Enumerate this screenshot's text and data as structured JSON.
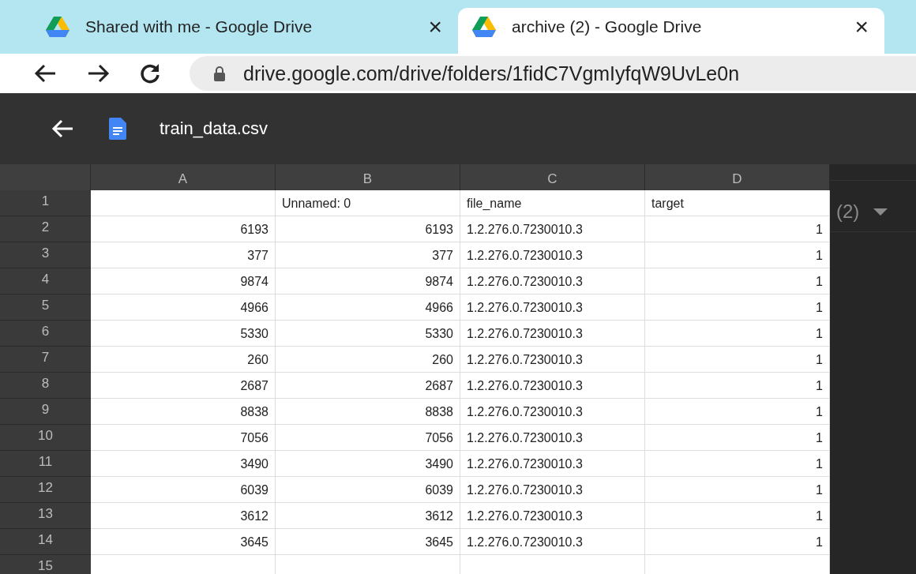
{
  "browser": {
    "tabs": [
      {
        "title": "Shared with me - Google Drive",
        "close": "×",
        "selected": false
      },
      {
        "title": "archive (2) - Google Drive",
        "close": "×",
        "selected": true
      }
    ],
    "url": "drive.google.com/drive/folders/1fidC7VgmIyfqW9UvLe0n"
  },
  "viewer": {
    "file_name": "train_data.csv",
    "background_text": "(2)"
  },
  "sheet": {
    "columns": [
      "A",
      "B",
      "C",
      "D"
    ],
    "rows": [
      {
        "number": "1",
        "cells": [
          "",
          "Unnamed: 0",
          "file_name",
          "target"
        ]
      },
      {
        "number": "2",
        "cells": [
          "6193",
          "6193",
          "1.2.276.0.7230010.3",
          "1"
        ]
      },
      {
        "number": "3",
        "cells": [
          "377",
          "377",
          "1.2.276.0.7230010.3",
          "1"
        ]
      },
      {
        "number": "4",
        "cells": [
          "9874",
          "9874",
          "1.2.276.0.7230010.3",
          "1"
        ]
      },
      {
        "number": "5",
        "cells": [
          "4966",
          "4966",
          "1.2.276.0.7230010.3",
          "1"
        ]
      },
      {
        "number": "6",
        "cells": [
          "5330",
          "5330",
          "1.2.276.0.7230010.3",
          "1"
        ]
      },
      {
        "number": "7",
        "cells": [
          "260",
          "260",
          "1.2.276.0.7230010.3",
          "1"
        ]
      },
      {
        "number": "8",
        "cells": [
          "2687",
          "2687",
          "1.2.276.0.7230010.3",
          "1"
        ]
      },
      {
        "number": "9",
        "cells": [
          "8838",
          "8838",
          "1.2.276.0.7230010.3",
          "1"
        ]
      },
      {
        "number": "10",
        "cells": [
          "7056",
          "7056",
          "1.2.276.0.7230010.3",
          "1"
        ]
      },
      {
        "number": "11",
        "cells": [
          "3490",
          "3490",
          "1.2.276.0.7230010.3",
          "1"
        ]
      },
      {
        "number": "12",
        "cells": [
          "6039",
          "6039",
          "1.2.276.0.7230010.3",
          "1"
        ]
      },
      {
        "number": "13",
        "cells": [
          "3612",
          "3612",
          "1.2.276.0.7230010.3",
          "1"
        ]
      },
      {
        "number": "14",
        "cells": [
          "3645",
          "3645",
          "1.2.276.0.7230010.3",
          "1"
        ]
      },
      {
        "number": "15"
      }
    ]
  }
}
